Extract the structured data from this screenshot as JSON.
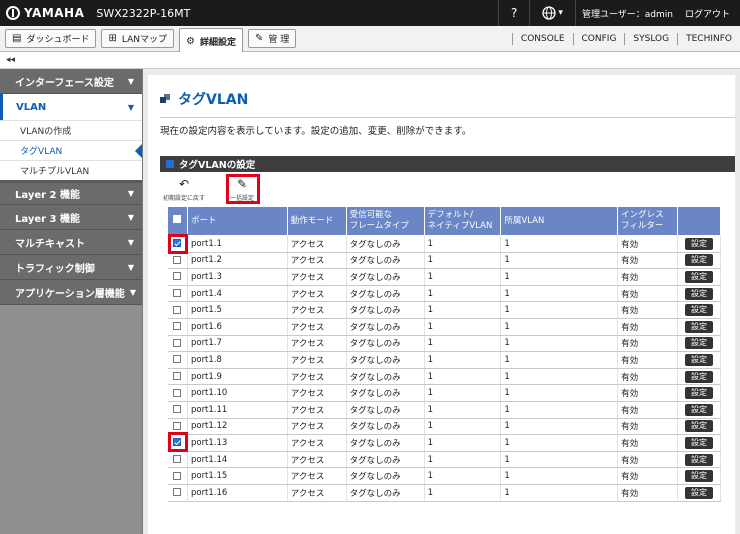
{
  "topbar": {
    "brand": "YAMAHA",
    "model": "SWX2322P-16MT",
    "help_label": "?",
    "lang_label": "▾",
    "user": "管理ユーザー：admin",
    "logout": "ログアウト"
  },
  "navbar": {
    "tabs": [
      {
        "label": "ダッシュボード",
        "icon": "dashboard-icon"
      },
      {
        "label": "LANマップ",
        "icon": "lan-map-icon"
      },
      {
        "label": "詳細設定",
        "icon": "gear-icon",
        "active": true
      },
      {
        "label": "管 理",
        "icon": "wrench-icon"
      }
    ],
    "links": [
      "CONSOLE",
      "CONFIG",
      "SYSLOG",
      "TECHINFO"
    ]
  },
  "collapse_label": "◂◂",
  "sidebar": {
    "top_item": "インターフェース設定",
    "open_item": "VLAN",
    "sub_items": [
      "VLANの作成",
      "タグVLAN",
      "マルチプルVLAN"
    ],
    "current_sub": "タグVLAN",
    "items": [
      "Layer 2 機能",
      "Layer 3 機能",
      "マルチキャスト",
      "トラフィック制御",
      "アプリケーション層機能"
    ]
  },
  "main": {
    "title": "タグVLAN",
    "description": "現在の設定内容を表示しています。設定の追加、変更、削除ができます。",
    "section_title": "タグVLANの設定",
    "tool_reset": "初期設定に戻す",
    "tool_bulk": "一括設定",
    "columns": [
      "ポート",
      "動作モード",
      "受信可能な\nフレームタイプ",
      "デフォルト/\nネイティブVLAN",
      "所属VLAN",
      "イングレス\nフィルター"
    ],
    "set_label": "設定",
    "rows": [
      {
        "port": "port1.1",
        "mode": "アクセス",
        "frame": "タグなしのみ",
        "native": "1",
        "vlan": "1",
        "filter": "有効",
        "checked": true
      },
      {
        "port": "port1.2",
        "mode": "アクセス",
        "frame": "タグなしのみ",
        "native": "1",
        "vlan": "1",
        "filter": "有効",
        "checked": false
      },
      {
        "port": "port1.3",
        "mode": "アクセス",
        "frame": "タグなしのみ",
        "native": "1",
        "vlan": "1",
        "filter": "有効",
        "checked": false
      },
      {
        "port": "port1.4",
        "mode": "アクセス",
        "frame": "タグなしのみ",
        "native": "1",
        "vlan": "1",
        "filter": "有効",
        "checked": false
      },
      {
        "port": "port1.5",
        "mode": "アクセス",
        "frame": "タグなしのみ",
        "native": "1",
        "vlan": "1",
        "filter": "有効",
        "checked": false
      },
      {
        "port": "port1.6",
        "mode": "アクセス",
        "frame": "タグなしのみ",
        "native": "1",
        "vlan": "1",
        "filter": "有効",
        "checked": false
      },
      {
        "port": "port1.7",
        "mode": "アクセス",
        "frame": "タグなしのみ",
        "native": "1",
        "vlan": "1",
        "filter": "有効",
        "checked": false
      },
      {
        "port": "port1.8",
        "mode": "アクセス",
        "frame": "タグなしのみ",
        "native": "1",
        "vlan": "1",
        "filter": "有効",
        "checked": false
      },
      {
        "port": "port1.9",
        "mode": "アクセス",
        "frame": "タグなしのみ",
        "native": "1",
        "vlan": "1",
        "filter": "有効",
        "checked": false
      },
      {
        "port": "port1.10",
        "mode": "アクセス",
        "frame": "タグなしのみ",
        "native": "1",
        "vlan": "1",
        "filter": "有効",
        "checked": false
      },
      {
        "port": "port1.11",
        "mode": "アクセス",
        "frame": "タグなしのみ",
        "native": "1",
        "vlan": "1",
        "filter": "有効",
        "checked": false
      },
      {
        "port": "port1.12",
        "mode": "アクセス",
        "frame": "タグなしのみ",
        "native": "1",
        "vlan": "1",
        "filter": "有効",
        "checked": false
      },
      {
        "port": "port1.13",
        "mode": "アクセス",
        "frame": "タグなしのみ",
        "native": "1",
        "vlan": "1",
        "filter": "有効",
        "checked": true
      },
      {
        "port": "port1.14",
        "mode": "アクセス",
        "frame": "タグなしのみ",
        "native": "1",
        "vlan": "1",
        "filter": "有効",
        "checked": false
      },
      {
        "port": "port1.15",
        "mode": "アクセス",
        "frame": "タグなしのみ",
        "native": "1",
        "vlan": "1",
        "filter": "有効",
        "checked": false
      },
      {
        "port": "port1.16",
        "mode": "アクセス",
        "frame": "タグなしのみ",
        "native": "1",
        "vlan": "1",
        "filter": "有効",
        "checked": false
      }
    ]
  },
  "colors": {
    "accent": "#0b5db5",
    "table_header": "#6a86c6",
    "highlight": "#e0001b"
  }
}
